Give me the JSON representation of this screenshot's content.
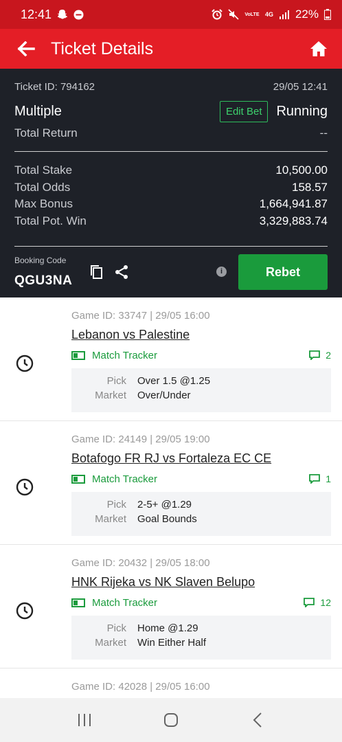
{
  "status_bar": {
    "time": "12:41",
    "battery": "22%",
    "network_volte": "VoLTE",
    "network_4g": "4G"
  },
  "app_bar": {
    "title": "Ticket Details"
  },
  "ticket": {
    "id_label": "Ticket ID: 794162",
    "datetime": "29/05 12:41",
    "bet_type": "Multiple",
    "edit_bet_label": "Edit Bet",
    "status": "Running",
    "total_return_label": "Total Return",
    "total_return_value": "--",
    "totals": [
      {
        "label": "Total Stake",
        "value": "10,500.00"
      },
      {
        "label": "Total Odds",
        "value": "158.57"
      },
      {
        "label": "Max Bonus",
        "value": "1,664,941.87"
      },
      {
        "label": "Total Pot. Win",
        "value": "3,329,883.74"
      }
    ],
    "booking_code_label": "Booking Code",
    "booking_code": "QGU3NA",
    "rebet_label": "Rebet"
  },
  "selections": [
    {
      "game_id": "Game ID: 33747 | 29/05 16:00",
      "match": "Lebanon vs Palestine",
      "tracker_label": "Match Tracker",
      "comments": "2",
      "pick_label": "Pick",
      "pick": "Over 1.5 @1.25",
      "market_label": "Market",
      "market": "Over/Under"
    },
    {
      "game_id": "Game ID: 24149 | 29/05 19:00",
      "match": "Botafogo FR RJ vs Fortaleza EC CE",
      "tracker_label": "Match Tracker",
      "comments": "1",
      "pick_label": "Pick",
      "pick": "2-5+ @1.29",
      "market_label": "Market",
      "market": "Goal Bounds"
    },
    {
      "game_id": "Game ID: 20432 | 29/05 18:00",
      "match": "HNK Rijeka vs NK Slaven Belupo",
      "tracker_label": "Match Tracker",
      "comments": "12",
      "pick_label": "Pick",
      "pick": "Home @1.29",
      "market_label": "Market",
      "market": "Win Either Half"
    }
  ],
  "partial_selection": {
    "game_id": "Game ID: 42028 | 29/05 16:00"
  },
  "colors": {
    "brand_red": "#e41e26",
    "dark_panel": "#1e2128",
    "accent_green": "#1a9b3c"
  }
}
